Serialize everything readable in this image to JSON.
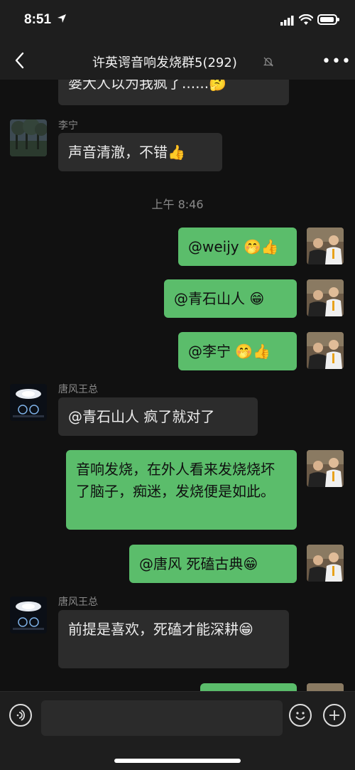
{
  "status_bar": {
    "time": "8:51"
  },
  "nav": {
    "title": "许英谔音响发烧群5(292)"
  },
  "messages": [
    {
      "side": "in",
      "sender": "",
      "text": "婆大人以为我疯了......🤔"
    },
    {
      "side": "in",
      "sender": "李宁",
      "text": "声音清澈，不错👍"
    },
    {
      "timestamp": "上午 8:46"
    },
    {
      "side": "out",
      "text": "@weijy 🤭👍"
    },
    {
      "side": "out",
      "text": "@青石山人 😁"
    },
    {
      "side": "out",
      "text": "@李宁 🤭👍"
    },
    {
      "side": "in",
      "sender": "唐风王总",
      "text": "@青石山人 疯了就对了"
    },
    {
      "side": "out",
      "text": "音响发烧，在外人看来发烧烧坏了脑子，痴迷，发烧便是如此。"
    },
    {
      "side": "out",
      "text": "@唐风 死磕古典😁"
    },
    {
      "side": "in",
      "sender": "唐风王总",
      "text": "前提是喜欢，死磕才能深耕😁"
    }
  ],
  "input": {
    "placeholder": ""
  },
  "colors": {
    "out_bubble": "#5bbd6b",
    "in_bubble": "#2c2c2c",
    "background": "#111111"
  }
}
